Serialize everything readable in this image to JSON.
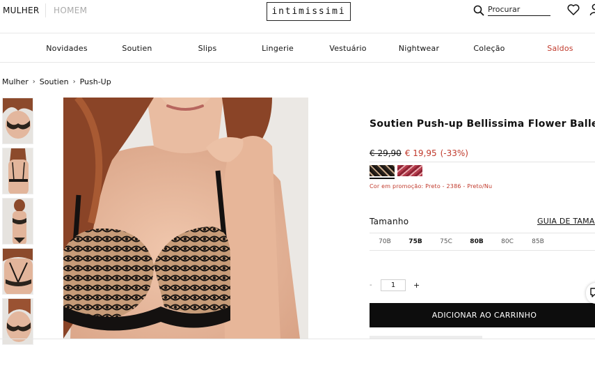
{
  "header": {
    "gender_tabs": [
      "MULHER",
      "HOMEM"
    ],
    "logo_text": "intimissimi",
    "search": {
      "placeholder": "Procurar"
    },
    "icons": [
      "search-icon",
      "heart-icon",
      "user-icon"
    ]
  },
  "nav": {
    "items": [
      "Novidades",
      "Soutien",
      "Slips",
      "Lingerie",
      "Vestuário",
      "Nightwear",
      "Coleção",
      "Saldos"
    ]
  },
  "breadcrumb": {
    "items": [
      "Mulher",
      "Soutien",
      "Push-Up"
    ],
    "separator": "›"
  },
  "product": {
    "title": "Soutien Push-up Bellissima Flower Ballet",
    "old_price": "€ 29,90",
    "new_price": "€ 19,95",
    "discount": "(-33%)",
    "swatches": [
      "black lace on nude",
      "pink/red lace"
    ],
    "promo_text": "Cor em promoção: Preto - 2386 - Preto/Nu",
    "size_label": "Tamanho",
    "size_guide": "GUIA DE TAMANHOS",
    "sizes": [
      {
        "label": "70B",
        "available": false
      },
      {
        "label": "75B",
        "available": true
      },
      {
        "label": "75C",
        "available": false
      },
      {
        "label": "80B",
        "available": true
      },
      {
        "label": "80C",
        "available": false
      },
      {
        "label": "85B",
        "available": false
      }
    ],
    "quantity": {
      "minus": "-",
      "value": "1",
      "plus": "+"
    },
    "add_to_cart": "ADICIONAR AO CARRINHO"
  },
  "colors": {
    "accent_sale": "#c0392b",
    "button_bg": "#0d0d0d",
    "text": "#111111"
  }
}
